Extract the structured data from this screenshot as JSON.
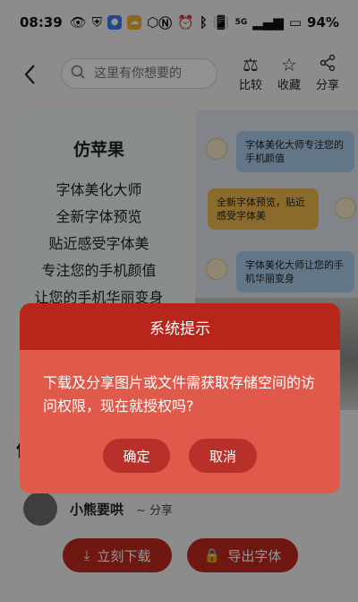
{
  "status_bar": {
    "time": "08:39",
    "battery": "94%",
    "network": "5G"
  },
  "topbar": {
    "search_placeholder": "这里有你想要的",
    "compare_label": "比较",
    "favorite_label": "收藏",
    "share_label": "分享"
  },
  "card_left": {
    "title": "仿苹果",
    "lines": [
      "字体美化大师",
      "全新字体预览",
      "贴近感受字体美",
      "专注您的手机颜值",
      "让您的手机华丽变身"
    ]
  },
  "card_right": {
    "bubbles": [
      "字体美化大师专注您的手机颜值",
      "全新字体预览，贴近感受字体美",
      "字体美化大师让您的手机华丽变身"
    ]
  },
  "product": {
    "title_partial": "仿"
  },
  "author": {
    "name": "小熊要哄",
    "action": "~ 分享"
  },
  "actions": {
    "download_label": "立刻下载",
    "export_label": "导出字体"
  },
  "dialog": {
    "title": "系统提示",
    "message": "下载及分享图片或文件需获取存储空间的访问权限，现在就授权吗?",
    "confirm_label": "确定",
    "cancel_label": "取消"
  },
  "colors": {
    "dialog_header": "#b8261b",
    "dialog_body": "#e05a4c",
    "button_red": "#c0281e"
  }
}
